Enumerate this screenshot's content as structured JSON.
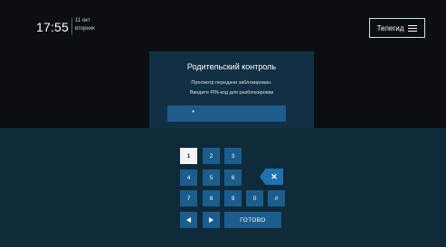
{
  "header": {
    "time": "17:55",
    "date_day": "11 окт",
    "date_weekday": "вторник",
    "teleguide_label": "Телегид"
  },
  "dialog": {
    "title": "Родительский контроль",
    "message_line1": "Просмотр передачи заблокирован.",
    "message_line2": "Введите PIN-код для разблокировки",
    "pin_value": "*"
  },
  "keypad": {
    "row1": [
      "1",
      "2",
      "3"
    ],
    "row2": [
      "4",
      "5",
      "6"
    ],
    "row3": [
      "7",
      "8",
      "9",
      "0",
      "#"
    ],
    "done_label": "ГОТОВО",
    "backspace_icon": "backspace-x-icon",
    "selected_key": "1"
  },
  "colors": {
    "background_top": "#0b0e13",
    "background_bottom": "#0f2a3b",
    "dialog": "#123044",
    "key": "#1b5e8d",
    "key_selected": "#f2f4f6",
    "accent": "#1f72b0"
  }
}
